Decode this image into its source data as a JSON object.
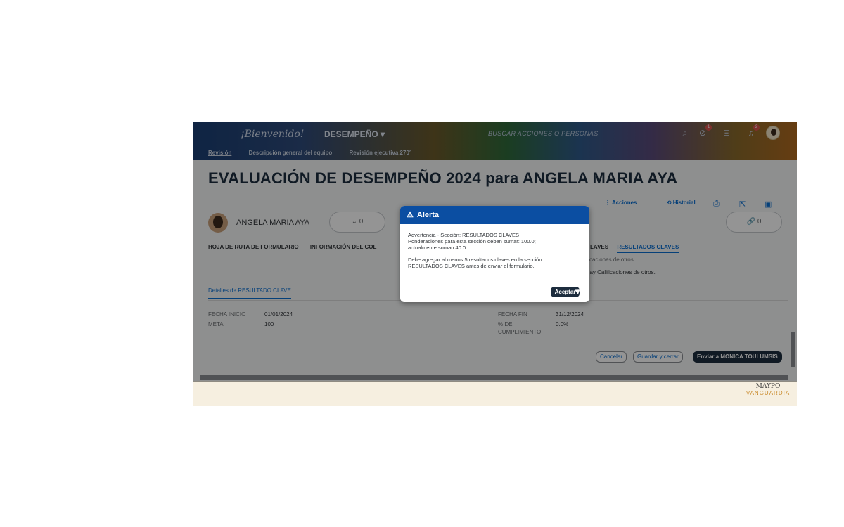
{
  "header": {
    "logo": "¡Bienvenido!",
    "module": "DESEMPEÑO ▾",
    "search_placeholder": "BUSCAR ACCIONES O PERSONAS",
    "badges": {
      "approvals": "1",
      "notifications": "2"
    },
    "tabs": [
      {
        "label": "Revisión"
      },
      {
        "label": "Descripción general del equipo"
      },
      {
        "label": "Revisión ejecutiva 270°"
      }
    ]
  },
  "page": {
    "title": "EVALUACIÓN DE DESEMPEÑO 2024 para ANGELA MARIA AYA",
    "actions": {
      "acciones": "Acciones",
      "historial": "Historial"
    },
    "person_name": "ANGELA MARIA AYA",
    "left_pill": "⌄ 0",
    "right_pill": "🔗 0",
    "section_tabs": [
      "HOJA DE RUTA DE FORMULARIO",
      "INFORMACIÓN DEL COL"
    ],
    "right_tabs": {
      "partial": "LAVES",
      "active": "RESULTADOS CLAVES"
    },
    "calif_line1": "ficaciones de otros",
    "calif_line2": "hay Calificaciones de otros.",
    "detail_tab": "Detalles de RESULTADO CLAVE",
    "fields": {
      "start_label": "FECHA INICIO",
      "start_value": "01/01/2024",
      "meta_label": "META",
      "meta_value": "100",
      "end_label": "FECHA FIN",
      "end_value": "31/12/2024",
      "pct_label_1": "% DE",
      "pct_label_2": "CUMPLIMIENTO",
      "pct_value": "0.0%"
    },
    "buttons": {
      "cancel": "Cancelar",
      "save_close": "Guardar y cerrar",
      "send": "Enviar a MONICA TOULUMSIS"
    }
  },
  "footer": {
    "brand_top": "MAYPO",
    "brand_bottom": "VANGUARDIA"
  },
  "dialog": {
    "title": "Alerta",
    "line1": "Advertencia - Sección: RESULTADOS CLAVES",
    "line2": "Ponderaciones para esta sección deben sumar: 100.0;",
    "line3": "actualmente suman 40.0.",
    "line4": "Debe agregar al menos 5 resultados claves en la sección",
    "line5": "RESULTADOS CLAVES antes de enviar el formulario.",
    "ok": "Aceptar"
  }
}
